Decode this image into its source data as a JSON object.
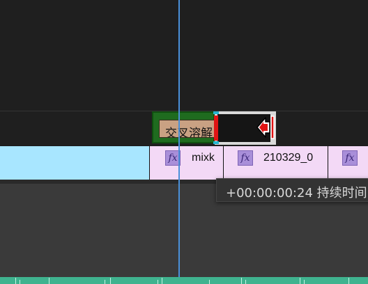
{
  "transition": {
    "label": "交叉溶解",
    "color": "#1f6b1f"
  },
  "clips": [
    {
      "fx_label": "fx",
      "name": "mixk"
    },
    {
      "fx_label": "fx",
      "name": "210329_0"
    },
    {
      "fx_label": "fx",
      "name": ""
    }
  ],
  "tooltip": {
    "text": "+00:00:00:24 持续时间"
  },
  "colors": {
    "playhead": "#4a90d9",
    "trim_edge": "#e01414",
    "audio_clip": "#a8e6ff",
    "video_clip": "#f3d9f6"
  },
  "icons": {
    "trim_cursor": "trim-arrow-icon"
  }
}
